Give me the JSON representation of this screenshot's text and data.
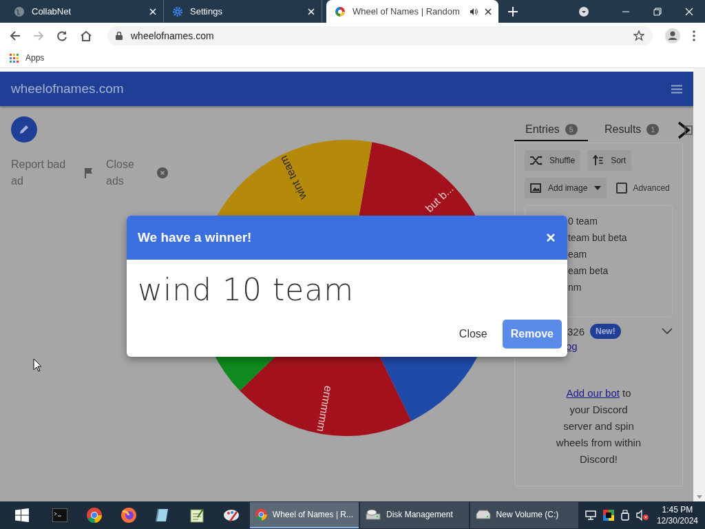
{
  "browser_tabs": [
    {
      "label": "CollabNet",
      "selected": false,
      "audio": false
    },
    {
      "label": "Settings",
      "selected": false,
      "audio": false
    },
    {
      "label": "Wheel of Names | Random",
      "selected": true,
      "audio": true
    }
  ],
  "address_bar": {
    "url": "wheelofnames.com"
  },
  "bookmarks": [
    {
      "label": "Apps"
    }
  ],
  "site_header": {
    "title": "wheelofnames.com"
  },
  "ad_links": [
    {
      "label": "Report bad ad",
      "kind": "flag"
    },
    {
      "label": "Close ads",
      "kind": "close"
    }
  ],
  "wheel": {
    "segments": [
      {
        "color": "#a3121c",
        "label": "but b..."
      },
      {
        "color": "#1f4aa8"
      },
      {
        "color": "#a3121c",
        "label": "ermmmm"
      },
      {
        "color": "#0e8a1e"
      },
      {
        "color": "#b5890a",
        "label": "wint team"
      }
    ]
  },
  "side_tabs": [
    {
      "label": "Entries",
      "count": "5",
      "selected": true
    },
    {
      "label": "Results",
      "count": "1",
      "selected": false
    }
  ],
  "entry_tools": {
    "shuffle": "Shuffle",
    "sort": "Sort",
    "add_image": "Add image",
    "advanced": {
      "label": "Advanced",
      "checked": false
    }
  },
  "entries": [
    "0 team",
    "team but beta",
    "eam",
    "eam beta",
    "nm"
  ],
  "version": {
    "number": "326",
    "badge": "New!",
    "changelog_link": "og"
  },
  "discord": {
    "link": "Add our bot",
    "text": " to your Discord server and spin wheels from within Discord!"
  },
  "dialog": {
    "title": "We have a winner!",
    "winner": "wind 10 team",
    "buttons": [
      {
        "label": "Close",
        "kind": "text"
      },
      {
        "label": "Remove",
        "kind": "primary"
      }
    ]
  },
  "taskbar": {
    "pinned": [
      {
        "kind": "terminal"
      },
      {
        "kind": "chrome"
      },
      {
        "kind": "firefox"
      },
      {
        "kind": "notebook"
      },
      {
        "kind": "notepad"
      },
      {
        "kind": "paint"
      }
    ],
    "tasks": [
      {
        "label": "Wheel of Names | R...",
        "selected": true
      },
      {
        "label": "Disk Management",
        "selected": false
      },
      {
        "label": "New Volume (C:)",
        "selected": false
      }
    ],
    "time": "1:45 PM",
    "date": "12/30/2024"
  }
}
